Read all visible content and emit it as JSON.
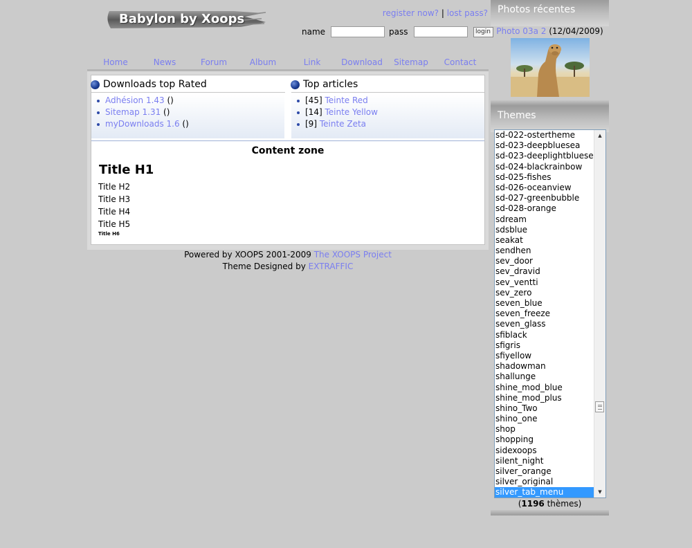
{
  "site": {
    "logo_text": "Babylon by Xoops"
  },
  "account": {
    "register_label": "register now?",
    "separator": " | ",
    "lostpass_label": "lost pass?",
    "name_label": "name",
    "pass_label": "pass",
    "name_value": "",
    "pass_value": "",
    "login_label": "login"
  },
  "nav": [
    {
      "label": "Home"
    },
    {
      "label": "News"
    },
    {
      "label": "Forum"
    },
    {
      "label": "Album"
    },
    {
      "label": "Link"
    },
    {
      "label": "Download"
    },
    {
      "label": "Sitemap"
    },
    {
      "label": "Contact"
    }
  ],
  "downloads_block": {
    "title": "Downloads top Rated",
    "items": [
      {
        "label": "Adhésion 1.43",
        "suffix": " ()"
      },
      {
        "label": "Sitemap 1.31",
        "suffix": " ()"
      },
      {
        "label": "myDownloads 1.6",
        "suffix": " ()"
      }
    ]
  },
  "articles_block": {
    "title": "Top articles",
    "items": [
      {
        "count": "[45]",
        "label": "Teinte Red"
      },
      {
        "count": "[14]",
        "label": "Teinte Yellow"
      },
      {
        "count": "[9]",
        "label": "Teinte Zeta"
      }
    ]
  },
  "content": {
    "zone_title": "Content zone",
    "h1": "Title H1",
    "h2": "Title H2",
    "h3": "Title H3",
    "h4": "Title H4",
    "h5": "Title H5",
    "h6": "Title H6"
  },
  "footer": {
    "powered_text": "Powered by XOOPS 2001-2009 ",
    "powered_link": "The XOOPS Project",
    "designed_text": "Theme Designed by  ",
    "designed_link": "EXTRAFFIC"
  },
  "photos": {
    "title": "Photos récentes",
    "caption_link": "Photo 03a 2",
    "caption_date": " (12/04/2009)"
  },
  "themes": {
    "title": "Themes",
    "items": [
      "sd-022-ostertheme",
      "sd-023-deepbluesea",
      "sd-023-deeplightbluesea",
      "sd-024-blackrainbow",
      "sd-025-fishes",
      "sd-026-oceanview",
      "sd-027-greenbubble",
      "sd-028-orange",
      "sdream",
      "sdsblue",
      "seakat",
      "sendhen",
      "sev_door",
      "sev_dravid",
      "sev_ventti",
      "sev_zero",
      "seven_blue",
      "seven_freeze",
      "seven_glass",
      "sfiblack",
      "sfigris",
      "sfiyellow",
      "shadowman",
      "shallunge",
      "shine_mod_blue",
      "shine_mod_plus",
      "shino_Two",
      "shino_one",
      "shop",
      "shopping",
      "sidexoops",
      "silent_night",
      "silver_orange",
      "silver_original",
      "silver_tab_menu"
    ],
    "selected": "silver_tab_menu",
    "count_open": "(",
    "count": "1196",
    "count_label": " thèmes)"
  },
  "colors": {
    "link": "#7a7ef0",
    "background": "#cbcbcb",
    "selection": "#3399ff"
  },
  "icons": {
    "block_bullet": "blue-orb-icon",
    "scroll_up": "scroll-up-arrow-icon",
    "scroll_down": "scroll-down-arrow-icon"
  }
}
